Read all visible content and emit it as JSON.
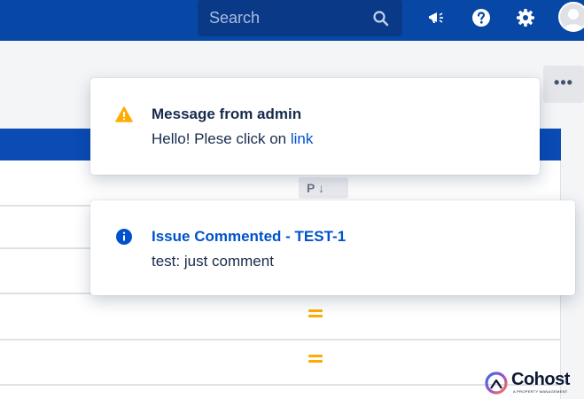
{
  "topbar": {
    "search_placeholder": "Search",
    "icons": [
      "megaphone-icon",
      "help-icon",
      "gear-icon",
      "user-avatar"
    ],
    "background": "#0747a6"
  },
  "toolbar": {
    "more_label": "•••"
  },
  "table": {
    "sort_label": "P ↓",
    "priority_icons": [
      "medium-priority-icon",
      "medium-priority-icon"
    ],
    "priority_color": "#ffab00"
  },
  "flags": [
    {
      "type": "warning",
      "icon": "warning-icon",
      "title": "Message from admin",
      "body_prefix": "Hello! Plese click on ",
      "link_text": "link",
      "icon_color": "#ffab00"
    },
    {
      "type": "info",
      "icon": "info-icon",
      "title": "Issue Commented - TEST-1",
      "body": "test: just comment",
      "title_color": "#0052cc",
      "icon_color": "#0052cc"
    }
  ],
  "watermark": {
    "brand": "Cohost",
    "tagline": "A PROPERTY MANAGEMENT"
  }
}
